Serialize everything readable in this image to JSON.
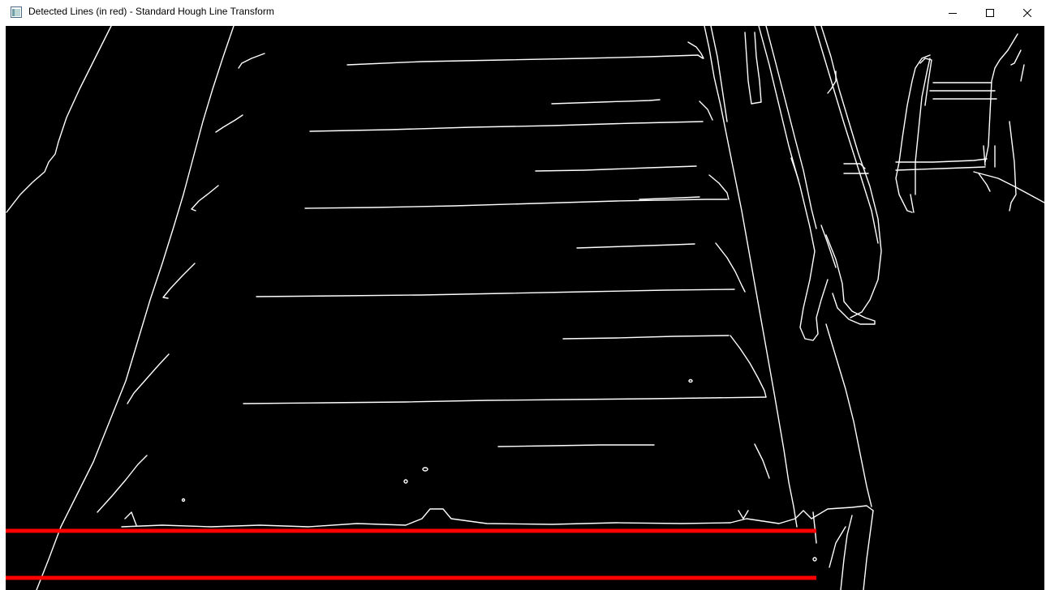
{
  "window": {
    "title": "Detected Lines (in red) - Standard Hough Line Transform"
  },
  "title_bar": {
    "app_icon": "window-app-icon",
    "buttons": [
      {
        "name": "minimize",
        "icon": "minimize-icon"
      },
      {
        "name": "maximize",
        "icon": "maximize-icon"
      },
      {
        "name": "close",
        "icon": "close-icon"
      }
    ]
  },
  "image": {
    "description_type": "canny-edge-map",
    "background_color": "#000000",
    "edge_color": "#ffffff",
    "detected_line_color": "#ff0000",
    "detected_lines_count": 2
  }
}
